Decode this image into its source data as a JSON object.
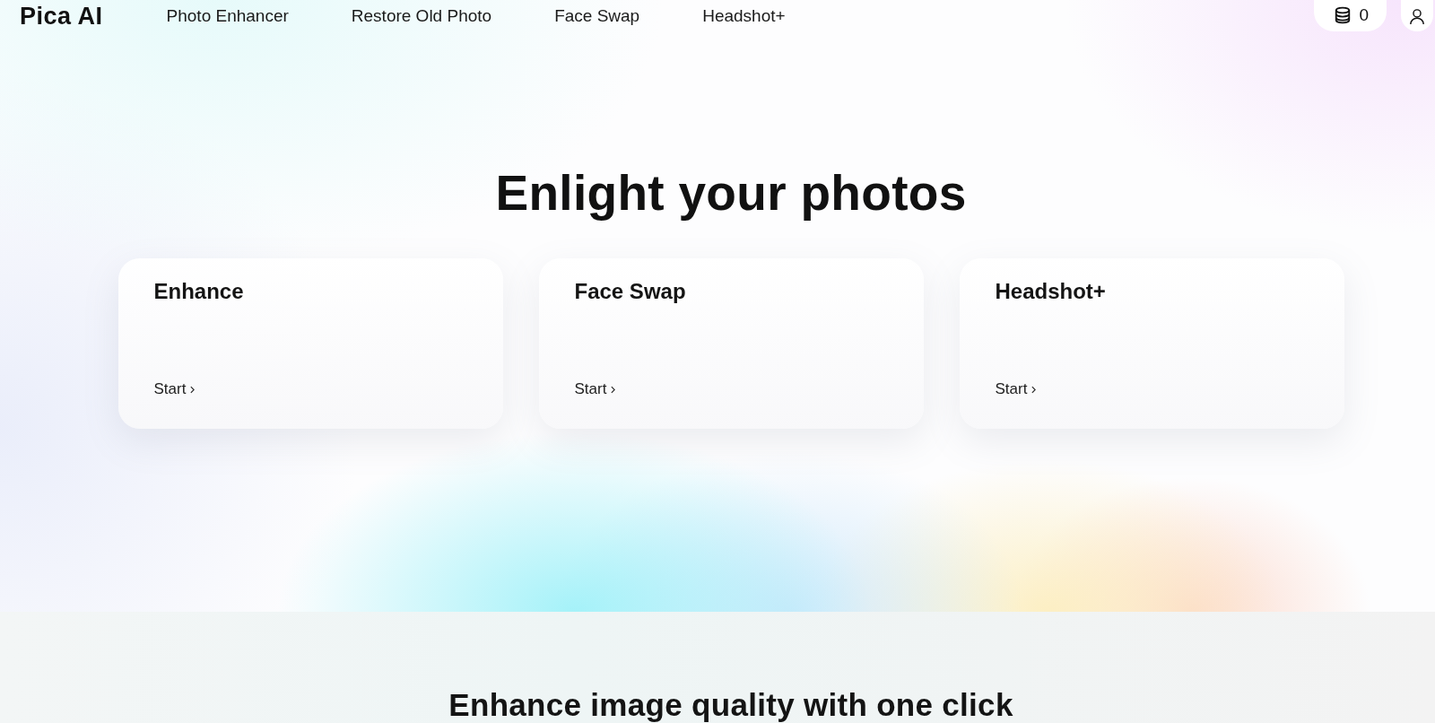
{
  "header": {
    "logo": "Pica AI",
    "nav": [
      {
        "label": "Photo Enhancer"
      },
      {
        "label": "Restore Old Photo"
      },
      {
        "label": "Face Swap"
      },
      {
        "label": "Headshot+"
      }
    ],
    "credits": "0"
  },
  "hero": {
    "title": "Enlight your photos",
    "cards": [
      {
        "title": "Enhance",
        "action": "Start"
      },
      {
        "title": "Face Swap",
        "action": "Start"
      },
      {
        "title": "Headshot+",
        "action": "Start"
      }
    ]
  },
  "section": {
    "title": "Enhance image quality with one click"
  }
}
